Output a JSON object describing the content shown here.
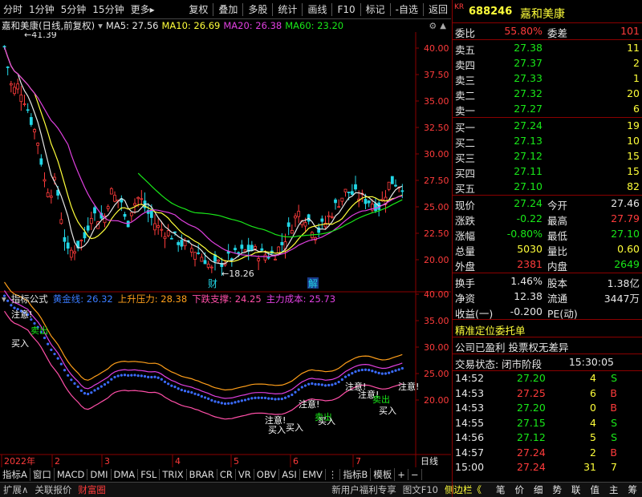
{
  "toolbar": {
    "left": [
      "分时",
      "1分钟",
      "5分钟",
      "15分钟",
      "更多▸"
    ],
    "right": [
      "复权",
      "叠加",
      "多股",
      "统计",
      "画线",
      "F10",
      "标记",
      "-自选",
      "返回"
    ]
  },
  "kline_title": {
    "name": "嘉和美康(日线,前复权)",
    "ma5": "MA5: 27.56",
    "ma10": "MA10: 26.69",
    "ma20": "MA20: 26.38",
    "ma60": "MA60: 23.20"
  },
  "indicator_title": {
    "name": "指标公式",
    "l1": "黄金线: 26.32",
    "l2": "上升压力: 28.38",
    "l3": "下跌支撑: 24.25",
    "l4": "主力成本: 25.73"
  },
  "axis": {
    "price_ticks": [
      "40.00",
      "37.50",
      "35.00",
      "32.50",
      "30.00",
      "27.50",
      "25.00",
      "22.50",
      "20.00"
    ],
    "ind_ticks": [
      "40.00",
      "35.00",
      "30.00",
      "25.00",
      "20.00"
    ],
    "x_labels": [
      "2022年",
      "2",
      "3",
      "4",
      "5",
      "6",
      "7"
    ],
    "period": "日线"
  },
  "annotations": {
    "high": "41.39",
    "low": "18.26",
    "cai": "财",
    "jie": "解",
    "sell": "卖出",
    "buy": "买入",
    "notice": "注意!"
  },
  "bottom_tabs": [
    "指标A",
    "窗口",
    "MACD",
    "DMI",
    "DMA",
    "FSL",
    "TRIX",
    "BRAR",
    "CR",
    "VR",
    "OBV",
    "ASI",
    "EMV",
    "⋮",
    "指标B",
    "模板",
    "+",
    "−"
  ],
  "statusbar": {
    "left": [
      "扩展∧",
      "关联报价",
      "财富圈"
    ],
    "mid": [
      "新用户福利专享",
      "图文F10",
      "侧边栏《"
    ],
    "right": [
      "笔",
      "价",
      "细",
      "势",
      "联",
      "值",
      "主",
      "筹"
    ]
  },
  "quote": {
    "market_tag": "KR",
    "code": "688246",
    "name": "嘉和美康",
    "weibi_label": "委比",
    "weibi": "55.80%",
    "weicha_label": "委差",
    "weicha": "101",
    "asks": [
      {
        "label": "卖五",
        "price": "27.38",
        "vol": "11"
      },
      {
        "label": "卖四",
        "price": "27.37",
        "vol": "2"
      },
      {
        "label": "卖三",
        "price": "27.33",
        "vol": "1"
      },
      {
        "label": "卖二",
        "price": "27.32",
        "vol": "20"
      },
      {
        "label": "卖一",
        "price": "27.27",
        "vol": "6"
      }
    ],
    "bids": [
      {
        "label": "买一",
        "price": "27.24",
        "vol": "19"
      },
      {
        "label": "买二",
        "price": "27.13",
        "vol": "10"
      },
      {
        "label": "买三",
        "price": "27.12",
        "vol": "15"
      },
      {
        "label": "买四",
        "price": "27.11",
        "vol": "15"
      },
      {
        "label": "买五",
        "price": "27.10",
        "vol": "82"
      }
    ],
    "stats": [
      {
        "l1": "现价",
        "v1": "27.24",
        "l2": "今开",
        "v2": "27.46",
        "c1": "green",
        "c2": "white"
      },
      {
        "l1": "涨跌",
        "v1": "-0.22",
        "l2": "最高",
        "v2": "27.79",
        "c1": "green",
        "c2": "red"
      },
      {
        "l1": "涨幅",
        "v1": "-0.80%",
        "l2": "最低",
        "v2": "27.10",
        "c1": "green",
        "c2": "green"
      },
      {
        "l1": "总量",
        "v1": "5030",
        "l2": "量比",
        "v2": "0.60",
        "c1": "yellow",
        "c2": "yellow"
      },
      {
        "l1": "外盘",
        "v1": "2381",
        "l2": "内盘",
        "v2": "2649",
        "c1": "red",
        "c2": "green"
      }
    ],
    "stats2": [
      {
        "l1": "换手",
        "v1": "1.46%",
        "l2": "股本",
        "v2": "1.38亿"
      },
      {
        "l1": "净资",
        "v1": "12.38",
        "l2": "流通",
        "v2": "3447万"
      },
      {
        "l1": "收益(一)",
        "v1": "-0.200",
        "l2": "PE(动)",
        "v2": ""
      }
    ],
    "banner": "精准定位委托单",
    "info1": "公司已盈利 投票权无差异",
    "state_label": "交易状态: 闭市阶段",
    "state_time": "15:30:05",
    "ticks": [
      {
        "t": "14:52",
        "p": "27.20",
        "v": "4",
        "d": "S"
      },
      {
        "t": "14:53",
        "p": "27.25",
        "v": "6",
        "d": "B"
      },
      {
        "t": "14:53",
        "p": "27.20",
        "v": "0",
        "d": "B"
      },
      {
        "t": "14:55",
        "p": "27.15",
        "v": "4",
        "d": "S"
      },
      {
        "t": "14:56",
        "p": "27.12",
        "v": "5",
        "d": "S"
      },
      {
        "t": "14:57",
        "p": "27.24",
        "v": "2",
        "d": "B"
      },
      {
        "t": "15:00",
        "p": "27.24",
        "v": "31",
        "d": "7"
      }
    ]
  }
}
